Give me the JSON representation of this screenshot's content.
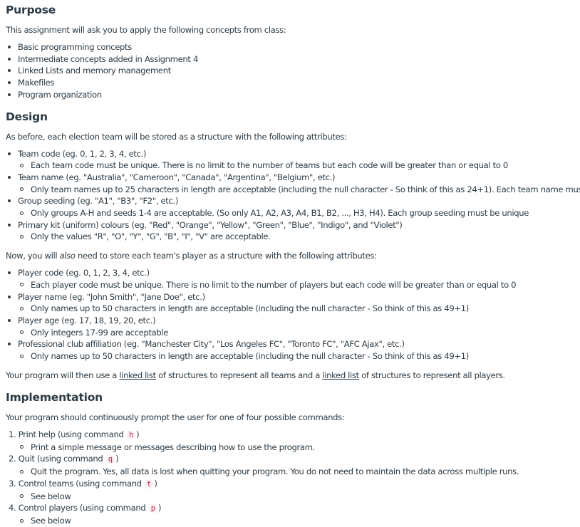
{
  "purpose": {
    "heading": "Purpose",
    "intro": "This assignment will ask you to apply the following concepts from class:",
    "items": [
      "Basic programming concepts",
      "Intermediate concepts added in Assignment 4",
      "Linked Lists and memory management",
      "Makefiles",
      "Program organization"
    ]
  },
  "design": {
    "heading": "Design",
    "intro": "As before, each election team will be stored as a structure with the following attributes:",
    "team_attributes": [
      {
        "label": "Team code (eg. 0, 1, 2, 3, 4, etc.)",
        "detail": "Each team code must be unique. There is no limit to the number of teams but each code will be greater than or equal to 0"
      },
      {
        "label": "Team name (eg. \"Australia\", \"Cameroon\", \"Canada\", \"Argentina\", \"Belgium\", etc.)",
        "detail": "Only team names up to 25 characters in length are acceptable (including the null character - So think of this as 24+1). Each team name must be"
      },
      {
        "label": "Group seeding (eg. \"A1\", \"B3\", \"F2\", etc.)",
        "detail": "Only groups A-H and seeds 1-4 are acceptable. (So only A1, A2, A3, A4, B1, B2, ..., H3, H4). Each group seeding must be unique"
      },
      {
        "label": "Primary kit (uniform) colours (eg. \"Red\", \"Orange\", \"Yellow\", \"Green\", \"Blue\", \"Indigo\", and \"Violet\")",
        "detail": "Only the values \"R\", \"O\", \"Y\", \"G\", \"B\", \"I\", \"V\" are acceptable."
      }
    ],
    "player_intro_pre": "Now, you will ",
    "player_intro_em": "also",
    "player_intro_post": " need to store each team's player as a structure with the following attributes:",
    "player_attributes": [
      {
        "label": "Player code (eg. 0, 1, 2, 3, 4, etc.)",
        "detail": "Each player code must be unique. There is no limit to the number of players but each code will be greater than or equal to 0"
      },
      {
        "label": "Player name (eg. \"John Smith\", \"Jane Doe\", etc.)",
        "detail": "Only names up to 50 characters in length are acceptable (including the null character - So think of this as 49+1)"
      },
      {
        "label": "Player age (eg. 17, 18, 19, 20, etc.)",
        "detail": "Only integers 17-99 are acceptable"
      },
      {
        "label": "Professional club affiliation (eg. \"Manchester City\", \"Los Angeles FC\", \"Toronto FC\", \"AFC Ajax\", etc.)",
        "detail": "Only names up to 50 characters in length are acceptable (including the null character - So think of this as 49+1)"
      }
    ],
    "linked_pre": "Your program will then use a ",
    "linked_link1": "linked list",
    "linked_mid": " of structures to represent all teams and a ",
    "linked_link2": "linked list",
    "linked_post": " of structures to represent all players."
  },
  "implementation": {
    "heading": "Implementation",
    "intro": "Your program should continuously prompt the user for one of four possible commands:",
    "commands": [
      {
        "num": "1.",
        "pre": "Print help (using command ",
        "code": "h",
        "post": ")",
        "detail": "Print a simple message or messages describing how to use the program."
      },
      {
        "num": "2.",
        "pre": "Quit (using command ",
        "code": "q",
        "post": ")",
        "detail": "Quit the program. Yes, all data is lost when quitting your program. You do not need to maintain the data across multiple runs."
      },
      {
        "num": "3.",
        "pre": "Control teams (using command ",
        "code": "t",
        "post": ")",
        "detail": "See below"
      },
      {
        "num": "4.",
        "pre": "Control players (using command ",
        "code": "p",
        "post": ")",
        "detail": "See below"
      }
    ]
  }
}
